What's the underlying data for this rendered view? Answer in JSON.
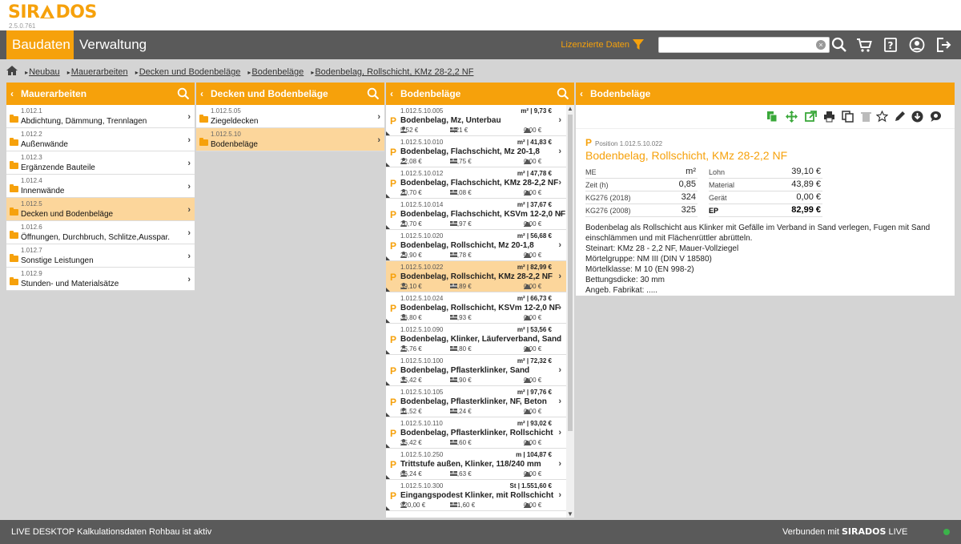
{
  "app": {
    "logo": "SIRADOS",
    "version": "2.5.0.761"
  },
  "nav": {
    "tabs": [
      "Baudaten",
      "Verwaltung"
    ],
    "licensed_label": "Lizenzierte Daten",
    "search_placeholder": "",
    "accent": "#f6a10b"
  },
  "breadcrumb": [
    "Neubau",
    "Mauerarbeiten",
    "Decken und Bodenbeläge",
    "Bodenbeläge",
    "Bodenbelag, Rollschicht, KMz 28-2,2 NF"
  ],
  "col1": {
    "title": "Mauerarbeiten",
    "items": [
      {
        "num": "1.012.1",
        "label": "Abdichtung, Dämmung, Trennlagen"
      },
      {
        "num": "1.012.2",
        "label": "Außenwände"
      },
      {
        "num": "1.012.3",
        "label": "Ergänzende Bauteile"
      },
      {
        "num": "1.012.4",
        "label": "Innenwände"
      },
      {
        "num": "1.012.5",
        "label": "Decken und Bodenbeläge",
        "selected": true
      },
      {
        "num": "1.012.6",
        "label": "Öffnungen, Durchbruch, Schlitze,Ausspar."
      },
      {
        "num": "1.012.7",
        "label": "Sonstige Leistungen"
      },
      {
        "num": "1.012.9",
        "label": "Stunden- und Materialsätze"
      }
    ]
  },
  "col2": {
    "title": "Decken und Bodenbeläge",
    "items": [
      {
        "num": "1.012.5.05",
        "label": "Ziegeldecken"
      },
      {
        "num": "1.012.5.10",
        "label": "Bodenbeläge",
        "selected": true
      }
    ]
  },
  "col3": {
    "title": "Bodenbeläge",
    "items": [
      {
        "num": "1.012.5.10.005",
        "unitprice": "m² | 9,73 €",
        "label": "Bodenbelag, Mz, Unterbau",
        "lohn": "5,52 €",
        "mat": "4,21 €",
        "geraet": "0,00 €"
      },
      {
        "num": "1.012.5.10.010",
        "unitprice": "m² | 41,83 €",
        "label": "Bodenbelag, Flachschicht, Mz 20-1,8",
        "lohn": "22,08 €",
        "mat": "19,75 €",
        "geraet": "0,00 €"
      },
      {
        "num": "1.012.5.10.012",
        "unitprice": "m² | 47,78 €",
        "label": "Bodenbelag, Flachschicht, KMz 28-2,2 NF",
        "lohn": "20,70 €",
        "mat": "27,08 €",
        "geraet": "0,00 €"
      },
      {
        "num": "1.012.5.10.014",
        "unitprice": "m² | 37,67 €",
        "label": "Bodenbelag, Flachschicht, KSVm 12-2,0 NF",
        "lohn": "20,70 €",
        "mat": "16,97 €",
        "geraet": "0,00 €"
      },
      {
        "num": "1.012.5.10.020",
        "unitprice": "m² | 56,68 €",
        "label": "Bodenbelag, Rollschicht, Mz 20-1,8",
        "lohn": "29,90 €",
        "mat": "26,78 €",
        "geraet": "0,00 €"
      },
      {
        "num": "1.012.5.10.022",
        "unitprice": "m² | 82,99 €",
        "label": "Bodenbelag, Rollschicht, KMz 28-2,2 NF",
        "lohn": "39,10 €",
        "mat": "43,89 €",
        "geraet": "0,00 €",
        "selected": true
      },
      {
        "num": "1.012.5.10.024",
        "unitprice": "m² | 66,73 €",
        "label": "Bodenbelag, Rollschicht, KSVm 12-2,0 NF",
        "lohn": "36,80 €",
        "mat": "29,93 €",
        "geraet": "0,00 €"
      },
      {
        "num": "1.012.5.10.090",
        "unitprice": "m² | 53,56 €",
        "label": "Bodenbelag, Klinker, Läuferverband, Sand",
        "lohn": "25,76 €",
        "mat": "27,80 €",
        "geraet": "0,00 €"
      },
      {
        "num": "1.012.5.10.100",
        "unitprice": "m² | 72,32 €",
        "label": "Bodenbelag, Pflasterklinker, Sand",
        "lohn": "35,42 €",
        "mat": "36,90 €",
        "geraet": "0,00 €"
      },
      {
        "num": "1.012.5.10.105",
        "unitprice": "m² | 97,76 €",
        "label": "Bodenbelag, Pflasterklinker, NF, Beton",
        "lohn": "51,52 €",
        "mat": "46,24 €",
        "geraet": "0,00 €"
      },
      {
        "num": "1.012.5.10.110",
        "unitprice": "m² | 93,02 €",
        "label": "Bodenbelag, Pflasterklinker, Rollschicht",
        "lohn": "35,42 €",
        "mat": "57,60 €",
        "geraet": "0,00 €"
      },
      {
        "num": "1.012.5.10.250",
        "unitprice": "m | 104,87 €",
        "label": "Trittstufe außen, Klinker, 118/240 mm",
        "lohn": "66,24 €",
        "mat": "38,63 €",
        "geraet": "0,00 €"
      },
      {
        "num": "1.012.5.10.300",
        "unitprice": "St | 1.551,60 €",
        "label": "Eingangspodest Klinker, mit Rollschicht",
        "lohn": "920,00 €",
        "mat": "631,60 €",
        "geraet": "0,00 €"
      }
    ]
  },
  "detail": {
    "title": "Bodenbeläge",
    "position_label": "Position",
    "position_num": "1.012.5.10.022",
    "position_title": "Bodenbelag, Rollschicht, KMz 28-2,2 NF",
    "left_table": [
      {
        "k": "ME",
        "v": "m²"
      },
      {
        "k": "Zeit (h)",
        "v": "0,85"
      },
      {
        "k": "KG276 (2018)",
        "v": "324"
      },
      {
        "k": "KG276 (2008)",
        "v": "325"
      }
    ],
    "right_table": [
      {
        "k": "Lohn",
        "v": "39,10 €"
      },
      {
        "k": "Material",
        "v": "43,89 €"
      },
      {
        "k": "Gerät",
        "v": "0,00 €"
      },
      {
        "k": "EP",
        "v": "82,99 €"
      }
    ],
    "description": [
      "Bodenbelag als Rollschicht aus Klinker mit Gefälle im Verband in Sand verlegen, Fugen mit Sand",
      "einschlämmen und mit Flächenrüttler abrütteln.",
      "Steinart: KMz 28 - 2,2 NF, Mauer-Vollziegel",
      "Mörtelgruppe: NM III (DIN V 18580)",
      "Mörtelklasse: M 10 (EN 998-2)",
      "Bettungsdicke: 30 mm",
      "Angeb. Fabrikat: ....."
    ]
  },
  "footer": {
    "status": "LIVE DESKTOP Kalkulationsdaten Rohbau ist aktiv",
    "connected_prefix": "Verbunden mit",
    "connected_brand": "SIRADOS",
    "connected_suffix": "LIVE",
    "status_color": "#3bb34a"
  }
}
